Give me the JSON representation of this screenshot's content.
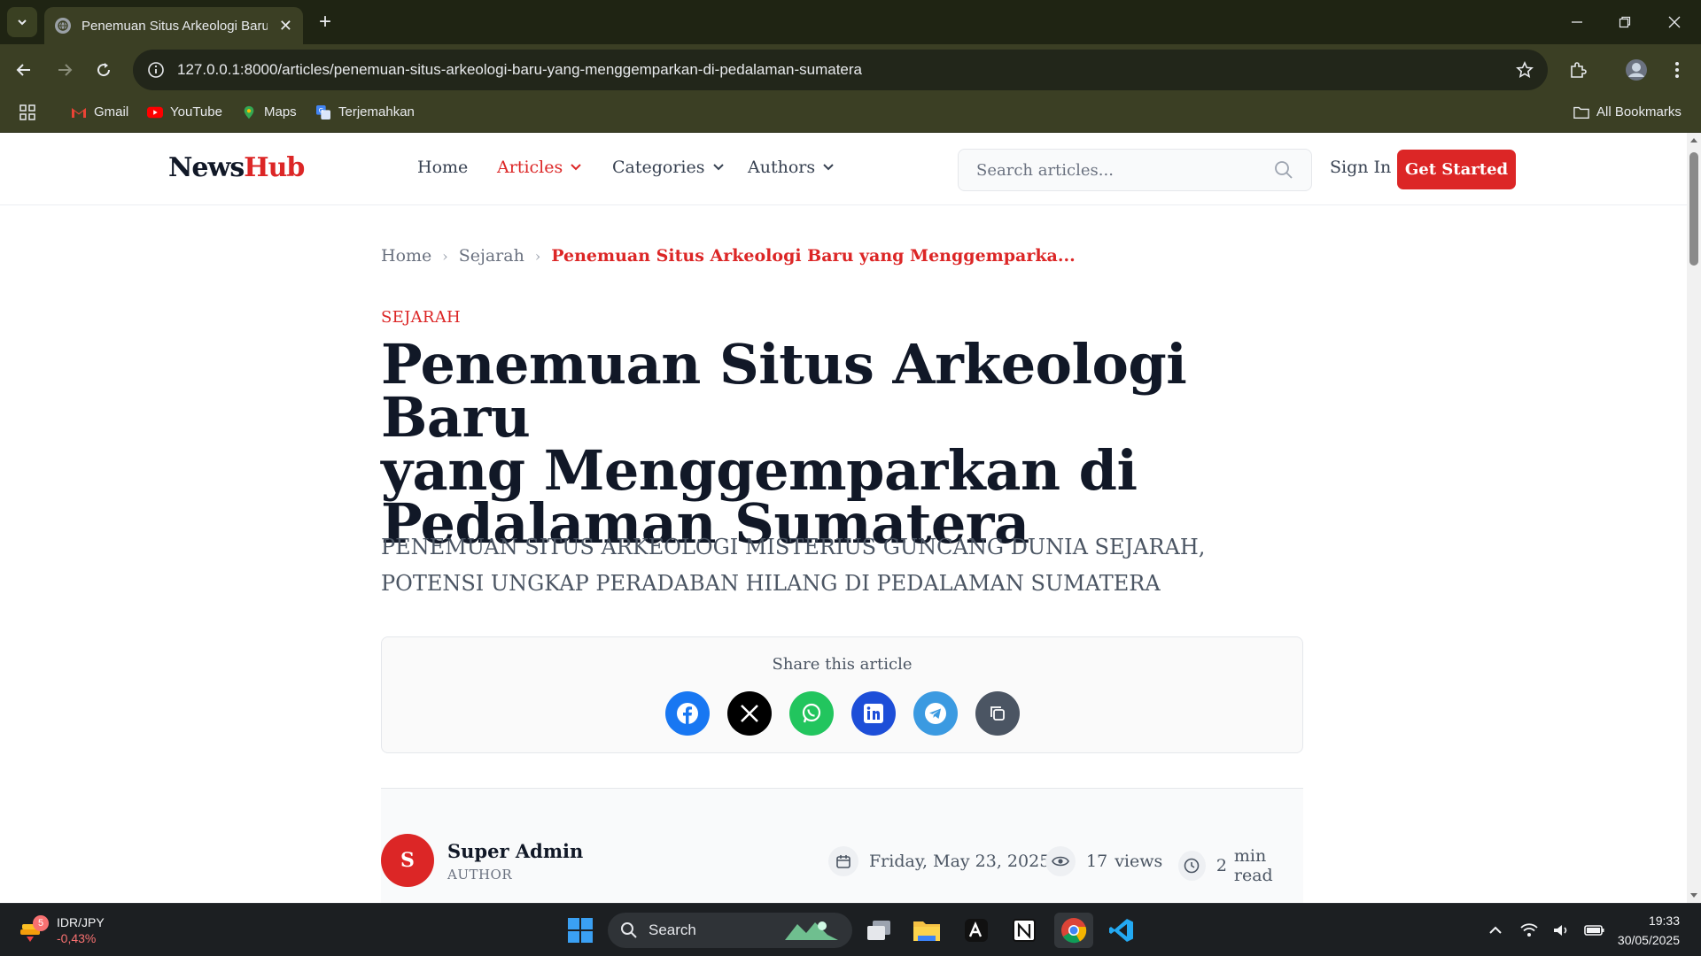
{
  "browser": {
    "tab_title": "Penemuan Situs Arkeologi Baru yang Menggemparkan di Pedalaman Sumatera",
    "url": "127.0.0.1:8000/articles/penemuan-situs-arkeologi-baru-yang-menggemparkan-di-pedalaman-sumatera",
    "bookmarks": [
      "Gmail",
      "YouTube",
      "Maps",
      "Terjemahkan"
    ],
    "all_bookmarks": "All Bookmarks"
  },
  "site": {
    "logo_part1": "News",
    "logo_part2": "Hub",
    "nav": [
      "Home",
      "Articles",
      "Categories",
      "Authors"
    ],
    "search_placeholder": "Search articles...",
    "signin": "Sign In",
    "get_started": "Get Started",
    "accent_color": "#dc2626"
  },
  "breadcrumb": [
    "Home",
    "Sejarah",
    "Penemuan Situs Arkeologi Baru yang Menggemparka..."
  ],
  "article": {
    "category": "SEJARAH",
    "title_lines": [
      "Penemuan Situs Arkeologi Baru",
      "yang Menggemparkan di",
      "Pedalaman Sumatera"
    ],
    "subtitle": "PENEMUAN SITUS ARKEOLOGI MISTERIUS GUNCANG DUNIA SEJARAH, POTENSI UNGKAP PERADABAN HILANG DI PEDALAMAN SUMATERA",
    "share_label": "Share this article",
    "share_buttons": [
      "facebook-icon",
      "x-icon",
      "whatsapp-icon",
      "linkedin-icon",
      "telegram-icon",
      "copy-icon"
    ],
    "author_initial": "S",
    "author_name": "Super Admin",
    "author_role": "AUTHOR",
    "date": "Friday, May 23, 2025",
    "views_count": "17",
    "views_label": "views",
    "read_count": "2",
    "read_label": "min read"
  },
  "taskbar": {
    "ticker": "IDR/JPY",
    "ticker_change": "-0,43%",
    "badge": "5",
    "search": "Search",
    "time": "19:33",
    "date": "30/05/2025"
  }
}
